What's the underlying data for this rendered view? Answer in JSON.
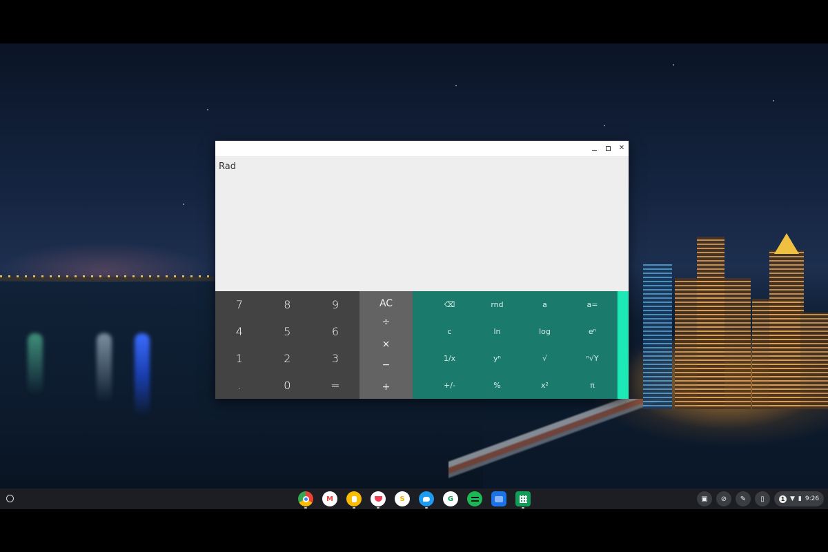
{
  "calculator": {
    "mode": "Rad",
    "window_controls": {
      "minimize": "‒",
      "maximize": "□",
      "close": "✕"
    },
    "number_keys": [
      [
        "7",
        "8",
        "9"
      ],
      [
        "4",
        "5",
        "6"
      ],
      [
        "1",
        "2",
        "3"
      ],
      [
        ".",
        "0",
        "="
      ]
    ],
    "operator_keys": [
      "AC",
      "÷",
      "×",
      "−",
      "+"
    ],
    "advanced_keys": [
      [
        "⌫",
        "rnd",
        "a",
        "a="
      ],
      [
        "c",
        "ln",
        "log",
        "eⁿ"
      ],
      [
        "1/x",
        "yⁿ",
        "√",
        "ⁿ√Y"
      ],
      [
        "+/-",
        "%",
        "x²",
        "π"
      ]
    ],
    "colors": {
      "number_pad": "#434343",
      "operator_pad": "#636363",
      "advanced_pad": "#1a7b6d",
      "accent_tab": "#1de9b6"
    }
  },
  "shelf": {
    "apps": [
      {
        "name": "chrome-icon",
        "glyph": ""
      },
      {
        "name": "gmail-icon",
        "glyph": "M"
      },
      {
        "name": "keep-icon",
        "glyph": ""
      },
      {
        "name": "pocket-icon",
        "glyph": ""
      },
      {
        "name": "slides-icon",
        "glyph": "S"
      },
      {
        "name": "twitter-icon",
        "glyph": ""
      },
      {
        "name": "classroom-icon",
        "glyph": "G"
      },
      {
        "name": "spotify-icon",
        "glyph": ""
      },
      {
        "name": "files-icon",
        "glyph": ""
      },
      {
        "name": "sheets-icon",
        "glyph": ""
      }
    ],
    "tray": {
      "notification_count": "1",
      "time": "9:26"
    }
  }
}
